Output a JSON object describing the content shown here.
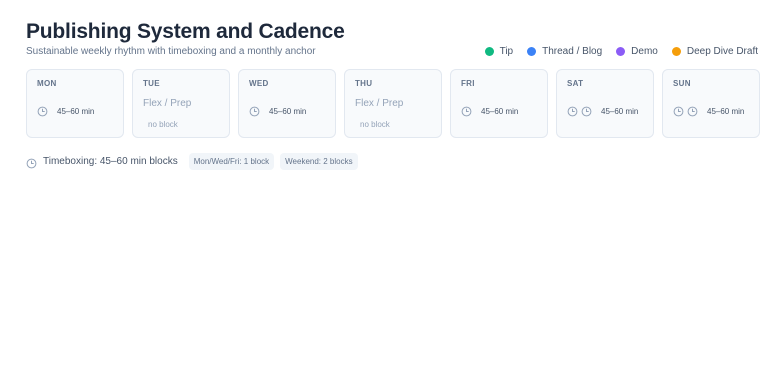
{
  "header": {
    "title": "Publishing System and Cadence",
    "subtitle": "Sustainable weekly rhythm with timeboxing and a monthly anchor"
  },
  "legend": [
    {
      "label": "Tip",
      "color": "#10b981"
    },
    {
      "label": "Thread / Blog",
      "color": "#3b82f6"
    },
    {
      "label": "Demo",
      "color": "#8b5cf6"
    },
    {
      "label": "Deep Dive Draft",
      "color": "#f59e0b"
    }
  ],
  "days": {
    "mon": {
      "name": "MON",
      "duration": "45–60 min"
    },
    "tue": {
      "name": "TUE",
      "flex": "Flex / Prep",
      "empty": "no block"
    },
    "wed": {
      "name": "WED",
      "duration": "45–60 min"
    },
    "thu": {
      "name": "THU",
      "flex": "Flex / Prep",
      "empty": "no block"
    },
    "fri": {
      "name": "FRI",
      "duration": "45–60 min"
    },
    "sat": {
      "name": "SAT",
      "duration": "45–60 min"
    },
    "sun": {
      "name": "SUN",
      "duration": "45–60 min"
    }
  },
  "footer": {
    "timeboxing": "Timeboxing: 45–60 min blocks",
    "chips": [
      "Mon/Wed/Fri: 1 block",
      "Weekend: 2 blocks"
    ]
  },
  "icons": {
    "block": "clock-icon"
  },
  "colors": {
    "card_bg": "#f8fafc",
    "card_border": "#e2e8f0",
    "icon": "#94a3b8"
  }
}
